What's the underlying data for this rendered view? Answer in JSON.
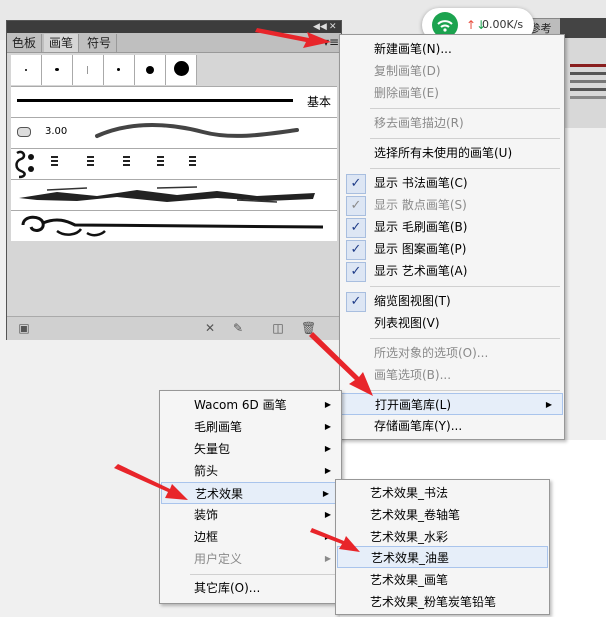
{
  "net_widget": {
    "speed": "0.00K/s"
  },
  "background": {
    "tab_label": "符参考"
  },
  "brush_panel": {
    "tabs": [
      "色板",
      "画笔",
      "符号"
    ],
    "basic_label": "基本",
    "calligraphy_size": "3.00"
  },
  "main_menu": {
    "new_brush": "新建画笔(N)...",
    "duplicate_brush": "复制画笔(D)",
    "delete_brush": "删除画笔(E)",
    "remove_stroke": "移去画笔描边(R)",
    "select_unused": "选择所有未使用的画笔(U)",
    "show_calligraphic": "显示 书法画笔(C)",
    "show_scatter": "显示 散点画笔(S)",
    "show_bristle": "显示 毛刷画笔(B)",
    "show_pattern": "显示 图案画笔(P)",
    "show_art": "显示 艺术画笔(A)",
    "thumbnail_view": "缩览图视图(T)",
    "list_view": "列表视图(V)",
    "selected_options": "所选对象的选项(O)...",
    "brush_options": "画笔选项(B)...",
    "open_library": "打开画笔库(L)",
    "save_library": "存储画笔库(Y)..."
  },
  "library_menu": {
    "items": [
      "Wacom 6D 画笔",
      "毛刷画笔",
      "矢量包",
      "箭头",
      "艺术效果",
      "装饰",
      "边框",
      "用户定义"
    ],
    "other": "其它库(O)..."
  },
  "art_menu": {
    "items": [
      "艺术效果_书法",
      "艺术效果_卷轴笔",
      "艺术效果_水彩",
      "艺术效果_油墨",
      "艺术效果_画笔",
      "艺术效果_粉笔炭笔铅笔"
    ]
  },
  "colors": {
    "arrow_red": "#e8252a",
    "check_blue": "#1f3c88"
  }
}
